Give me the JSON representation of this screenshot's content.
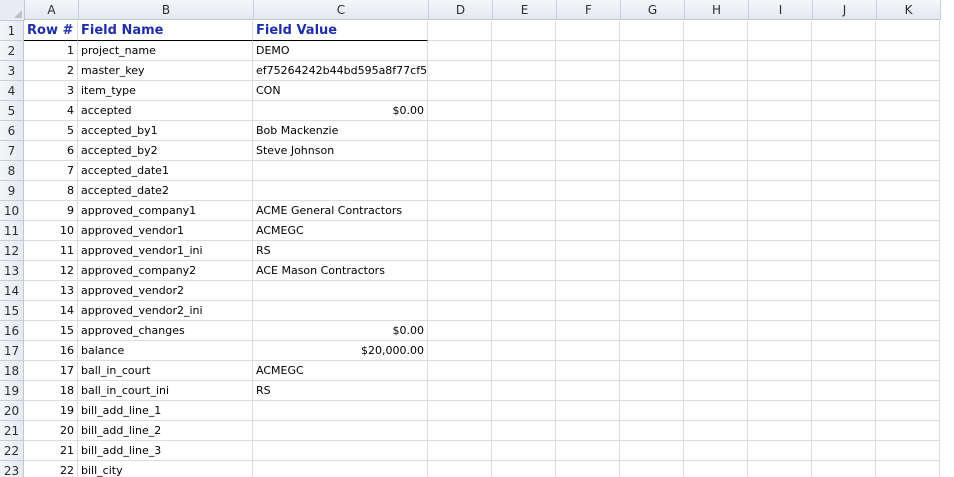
{
  "columns": [
    "A",
    "B",
    "C",
    "D",
    "E",
    "F",
    "G",
    "H",
    "I",
    "J",
    "K"
  ],
  "rows": [
    {
      "n": "1",
      "a": "Row #",
      "b": "Field Name",
      "c": "Field Value",
      "header": true
    },
    {
      "n": "2",
      "a": "1",
      "b": "project_name",
      "c": "DEMO"
    },
    {
      "n": "3",
      "a": "2",
      "b": "master_key",
      "c": "ef75264242b44bd595a8f77cf5"
    },
    {
      "n": "4",
      "a": "3",
      "b": "item_type",
      "c": "CON"
    },
    {
      "n": "5",
      "a": "4",
      "b": "accepted",
      "c": "$0.00",
      "cnum": true
    },
    {
      "n": "6",
      "a": "5",
      "b": "accepted_by1",
      "c": "Bob Mackenzie"
    },
    {
      "n": "7",
      "a": "6",
      "b": "accepted_by2",
      "c": "Steve Johnson"
    },
    {
      "n": "8",
      "a": "7",
      "b": "accepted_date1",
      "c": ""
    },
    {
      "n": "9",
      "a": "8",
      "b": "accepted_date2",
      "c": ""
    },
    {
      "n": "10",
      "a": "9",
      "b": "approved_company1",
      "c": "ACME General Contractors"
    },
    {
      "n": "11",
      "a": "10",
      "b": "approved_vendor1",
      "c": "ACMEGC"
    },
    {
      "n": "12",
      "a": "11",
      "b": "approved_vendor1_ini",
      "c": "RS"
    },
    {
      "n": "13",
      "a": "12",
      "b": "approved_company2",
      "c": "ACE Mason Contractors"
    },
    {
      "n": "14",
      "a": "13",
      "b": "approved_vendor2",
      "c": ""
    },
    {
      "n": "15",
      "a": "14",
      "b": "approved_vendor2_ini",
      "c": ""
    },
    {
      "n": "16",
      "a": "15",
      "b": "approved_changes",
      "c": "$0.00",
      "cnum": true
    },
    {
      "n": "17",
      "a": "16",
      "b": "balance",
      "c": "$20,000.00",
      "cnum": true
    },
    {
      "n": "18",
      "a": "17",
      "b": "ball_in_court",
      "c": "ACMEGC"
    },
    {
      "n": "19",
      "a": "18",
      "b": "ball_in_court_ini",
      "c": "RS"
    },
    {
      "n": "20",
      "a": "19",
      "b": "bill_add_line_1",
      "c": ""
    },
    {
      "n": "21",
      "a": "20",
      "b": "bill_add_line_2",
      "c": ""
    },
    {
      "n": "22",
      "a": "21",
      "b": "bill_add_line_3",
      "c": ""
    },
    {
      "n": "23",
      "a": "22",
      "b": "bill_city",
      "c": ""
    }
  ]
}
